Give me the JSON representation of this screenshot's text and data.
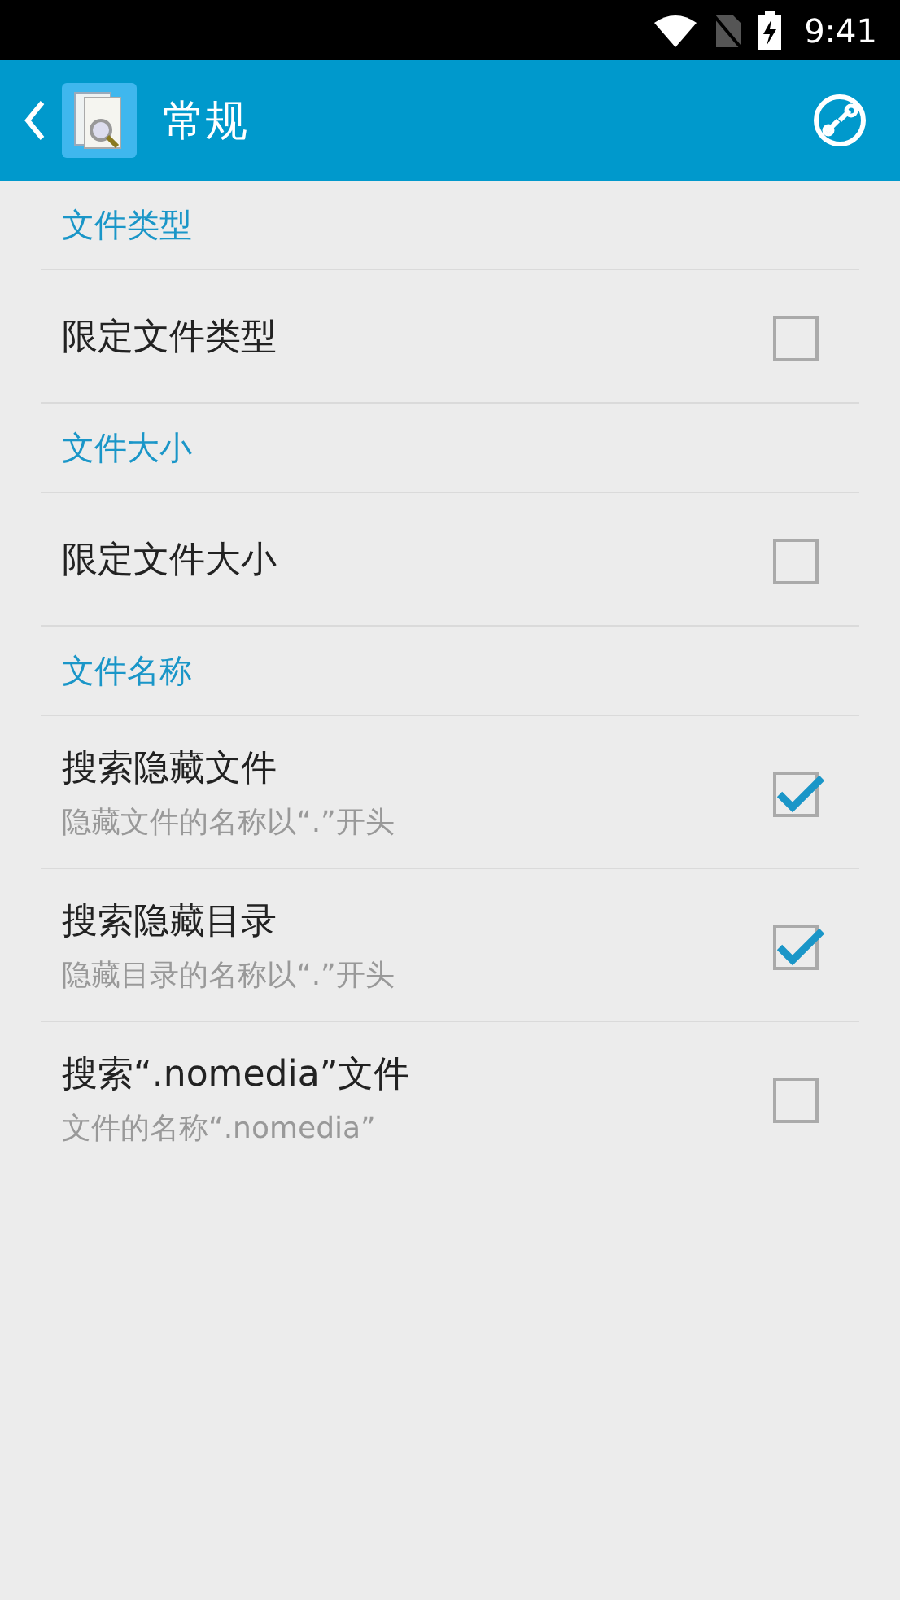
{
  "status_bar": {
    "time": "9:41"
  },
  "app_bar": {
    "title": "常规"
  },
  "sections": [
    {
      "title": "文件类型",
      "items": [
        {
          "title": "限定文件类型",
          "checked": false
        }
      ]
    },
    {
      "title": "文件大小",
      "items": [
        {
          "title": "限定文件大小",
          "checked": false
        }
      ]
    },
    {
      "title": "文件名称",
      "items": [
        {
          "title": "搜索隐藏文件",
          "subtitle": "隐藏文件的名称以“.”开头",
          "checked": true
        },
        {
          "title": "搜索隐藏目录",
          "subtitle": "隐藏目录的名称以“.”开头",
          "checked": true
        },
        {
          "title": "搜索“.nomedia”文件",
          "subtitle": "文件的名称“.nomedia”",
          "checked": false
        }
      ]
    }
  ]
}
